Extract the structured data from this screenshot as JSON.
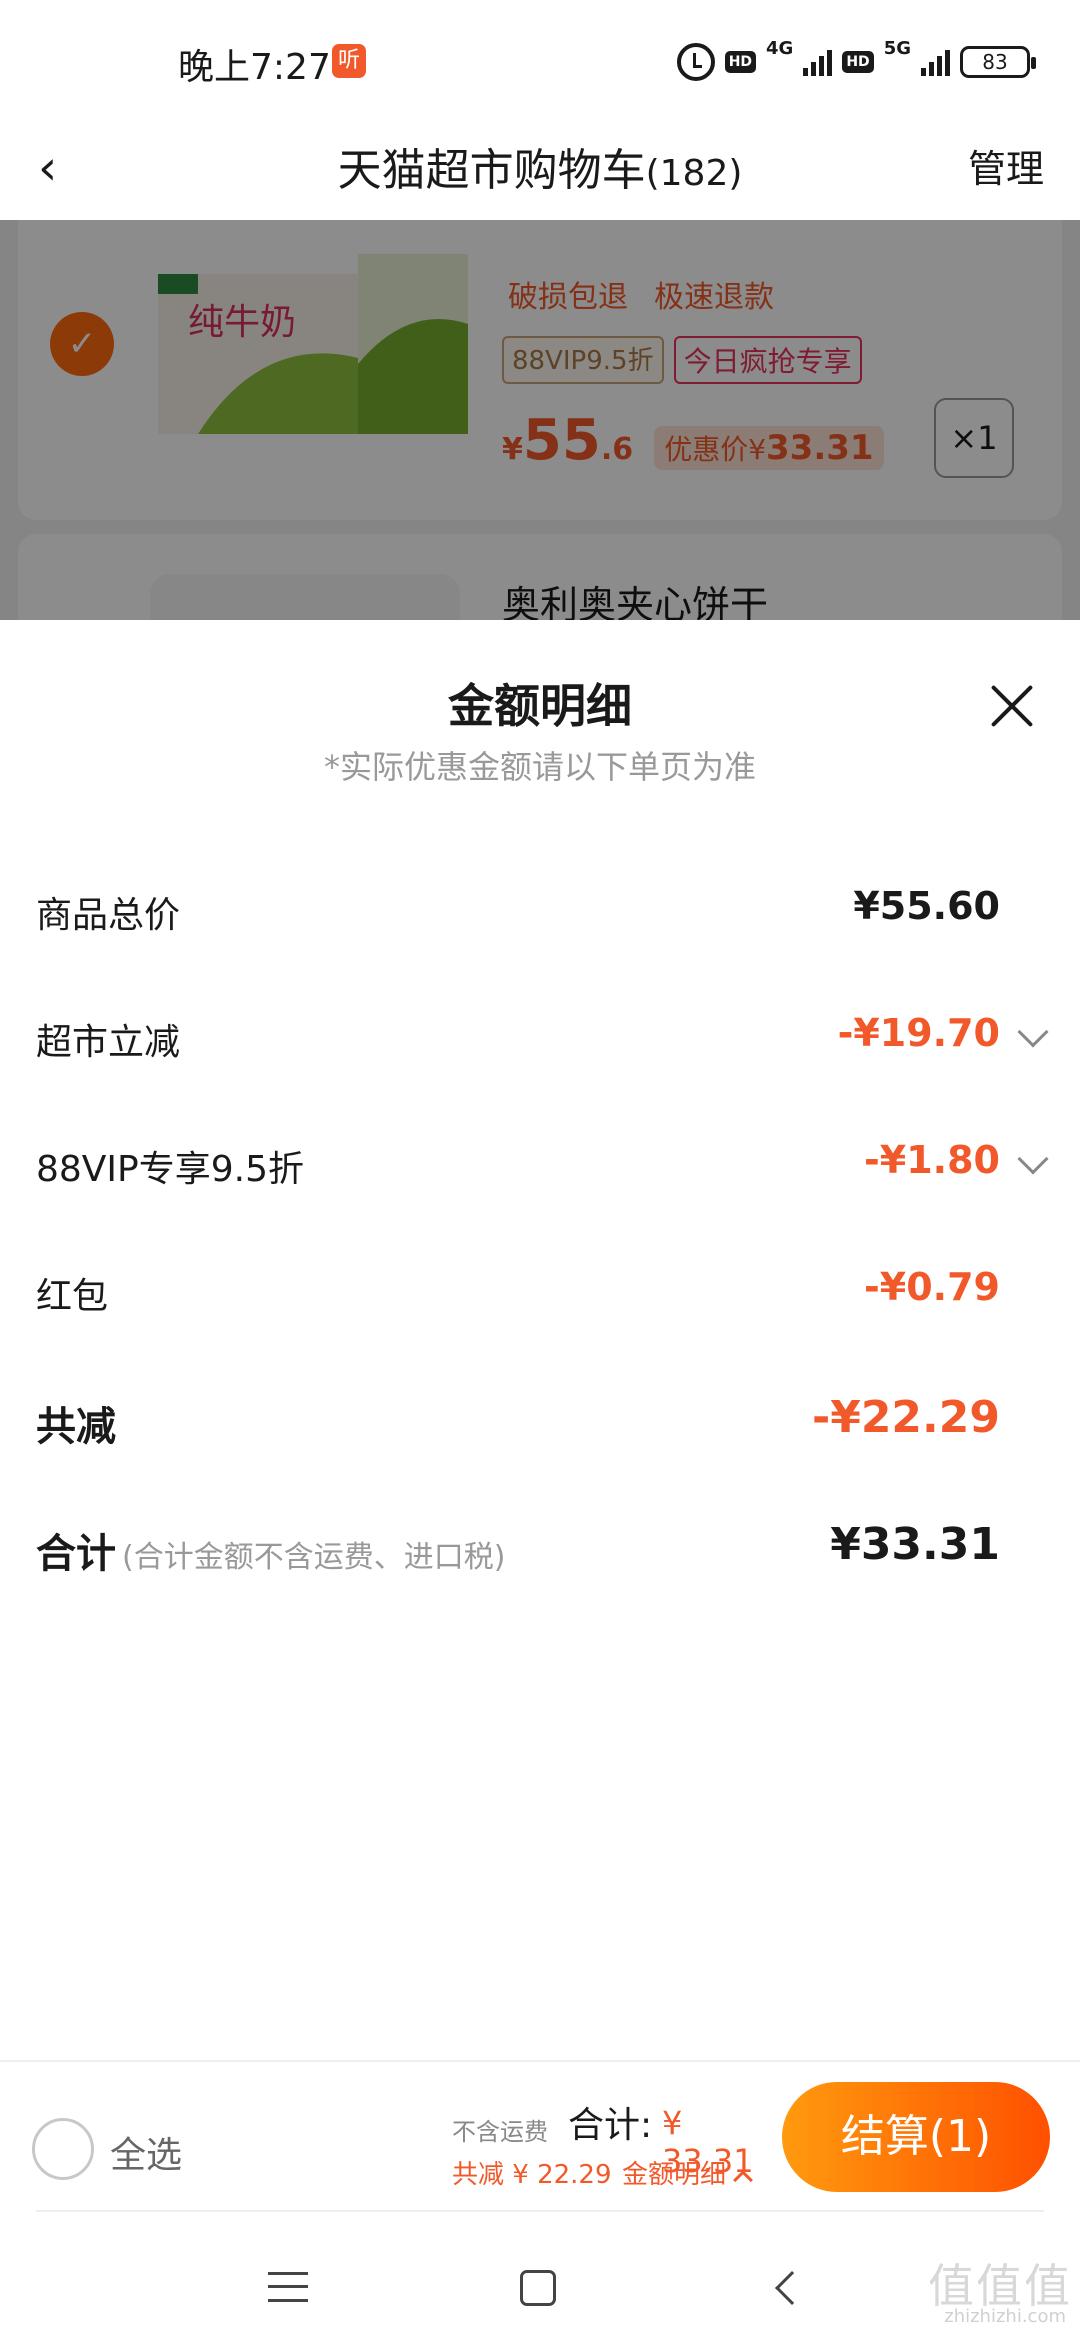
{
  "status_bar": {
    "time": "晚上7:27",
    "listen_badge": "听",
    "hd1": "HD",
    "net1": "4G",
    "hd2": "HD",
    "net2": "5G",
    "battery": "83"
  },
  "header": {
    "title": "天猫超市购物车",
    "count": "(182)",
    "manage": "管理"
  },
  "cart": {
    "item1": {
      "service_tags": [
        "破损包退",
        "极速退款"
      ],
      "tag_vip": "88VIP9.5折",
      "tag_rush": "今日疯抢专享",
      "price_symbol": "¥",
      "price_main": "55",
      "price_decimal": ".6",
      "promo_label": "优惠价¥",
      "promo_price": "33.31",
      "quantity": "×1",
      "image_text": "纯牛奶"
    },
    "item2": {
      "name": "奥利奥夹心饼干"
    }
  },
  "sheet": {
    "title": "金额明细",
    "subtitle": "*实际优惠金额请以下单页为准",
    "rows": [
      {
        "label": "商品总价",
        "value": "¥55.60"
      },
      {
        "label": "超市立减",
        "value": "-¥19.70"
      },
      {
        "label": "88VIP专享9.5折",
        "value": "-¥1.80"
      },
      {
        "label": "红包",
        "value": "-¥0.79"
      },
      {
        "label": "共减",
        "value": "-¥22.29"
      },
      {
        "label": "合计",
        "note": "(合计金额不含运费、进口税)",
        "value": "¥33.31"
      }
    ]
  },
  "checkout": {
    "select_all": "全选",
    "no_shipping": "不含运费",
    "total_label": "合计:",
    "total_value": "¥ 33.31",
    "saved": "共减 ¥ 22.29",
    "detail_link": "金额明细",
    "button": "结算(1)"
  },
  "watermark": {
    "main": "值值值",
    "sub": "zhizhizhi.com"
  },
  "colors": {
    "accent": "#f2592a",
    "checkout_start": "#ff9a0e",
    "checkout_end": "#ff5000"
  }
}
